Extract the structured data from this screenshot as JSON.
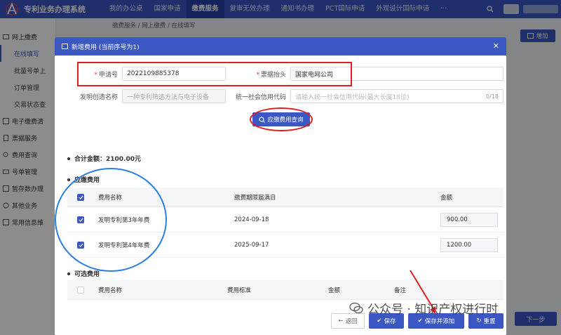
{
  "app": {
    "title": "专利业务办理系统"
  },
  "nav": {
    "items": [
      "我的办公桌",
      "国家申请",
      "缴费服务",
      "复审无效办理",
      "通知书办理",
      "PCT国际申请",
      "外观设计国际申请",
      "···"
    ],
    "active_index": 2
  },
  "sidebar": {
    "items": [
      {
        "label": "网上缴费",
        "level": 1
      },
      {
        "label": "在线填写",
        "level": 2,
        "active": true
      },
      {
        "label": "批量号单上",
        "level": 2
      },
      {
        "label": "订单管理",
        "level": 2
      },
      {
        "label": "交易状态查",
        "level": 2
      },
      {
        "label": "电子缴费清",
        "level": 1
      },
      {
        "label": "票据服务",
        "level": 1
      },
      {
        "label": "费用查询",
        "level": 1
      },
      {
        "label": "号单管理",
        "level": 1
      },
      {
        "label": "暂存数办理",
        "level": 1
      },
      {
        "label": "其他业务",
        "level": 1
      },
      {
        "label": "常用信息维",
        "level": 1
      }
    ]
  },
  "page": {
    "breadcrumb": "缴费服务 / 网上缴费 / 在线填写",
    "add_button": "增加",
    "next_button": "下一步"
  },
  "modal": {
    "title": "新增费用 (当前序号为1)",
    "fields": {
      "application_no": {
        "label": "申请号",
        "value": "2022109885378"
      },
      "invoice_title": {
        "label": "票据抬头",
        "value": "国家电网公司"
      },
      "invention_name": {
        "label": "发明创造名称",
        "value": "一种专利筛选方法与电子设备"
      },
      "credit_code": {
        "label": "统一社会信用代码",
        "placeholder": "请输入统一社会信用代码(最大长度18位)",
        "counter": "0/18"
      }
    },
    "query_button": "应缴费用查询",
    "total_label": "合计金额：2100.00元",
    "payable": {
      "section_title": "应缴费用",
      "headers": [
        "费用名称",
        "缴费期限届满日",
        "金额"
      ],
      "rows": [
        {
          "name": "发明专利第3年年费",
          "deadline": "2024-09-18",
          "amount": "900.00"
        },
        {
          "name": "发明专利第4年年费",
          "deadline": "2025-09-17",
          "amount": "1200.00"
        }
      ]
    },
    "optional": {
      "section_title": "可选费用",
      "headers": [
        "费用名称",
        "费用标准",
        "金额",
        "备注"
      ]
    },
    "buttons": {
      "back": "返回",
      "save": "保存",
      "save_add": "保存并添加",
      "reset": "重置"
    }
  },
  "watermark": {
    "text": "公众号 · 知识产权进行时"
  },
  "colors": {
    "brand": "#3a57c4",
    "annotation_red": "#e02020",
    "annotation_blue": "#2b7fe0"
  }
}
